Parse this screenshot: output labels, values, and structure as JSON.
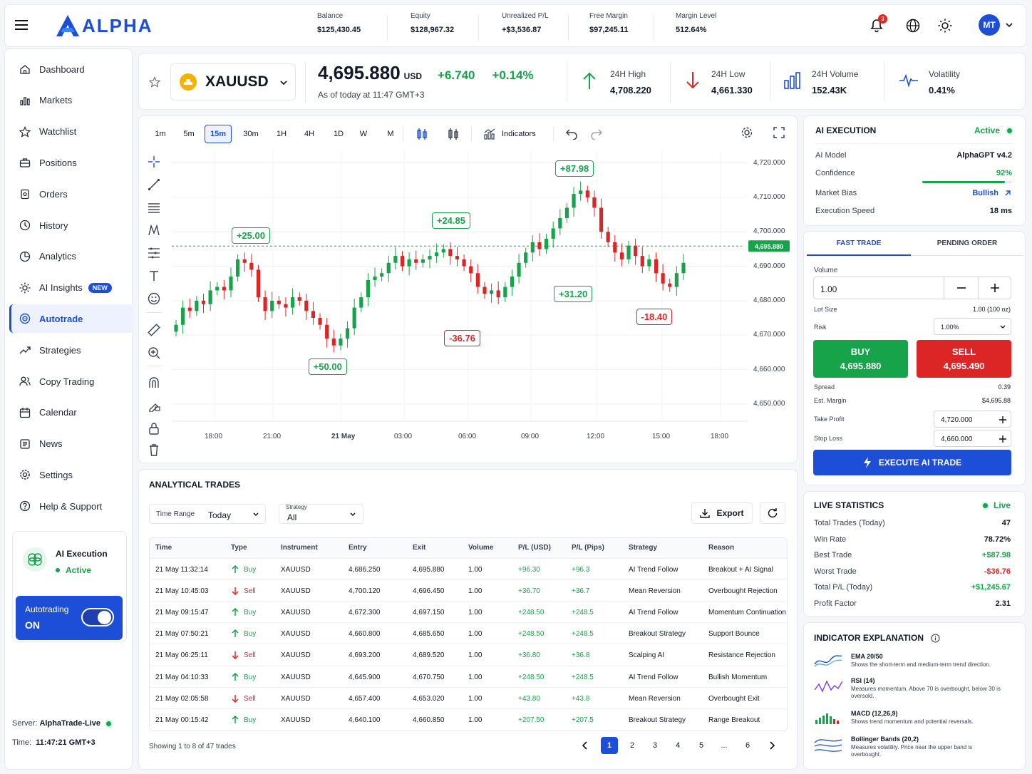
{
  "brand": {
    "name": "ALPHA"
  },
  "header": {
    "stats": [
      {
        "label": "Balance",
        "value": "$125,430.45"
      },
      {
        "label": "Equity",
        "value": "$128,967.32"
      },
      {
        "label": "Unrealized P/L",
        "value": "+$3,536.87"
      },
      {
        "label": "Free Margin",
        "value": "$97,245.11"
      },
      {
        "label": "Margin Level",
        "value": "512.64%"
      }
    ],
    "notification_count": "3",
    "avatar_initials": "MT"
  },
  "sidebar": {
    "items": [
      {
        "label": "Dashboard",
        "icon": "home-icon"
      },
      {
        "label": "Markets",
        "icon": "bar-chart-icon"
      },
      {
        "label": "Watchlist",
        "icon": "star-icon"
      },
      {
        "label": "Positions",
        "icon": "briefcase-icon"
      },
      {
        "label": "Orders",
        "icon": "clipboard-icon"
      },
      {
        "label": "History",
        "icon": "clock-icon"
      },
      {
        "label": "Analytics",
        "icon": "pie-icon"
      },
      {
        "label": "AI Insights",
        "icon": "sun-ai-icon",
        "badge": "NEW"
      },
      {
        "label": "Autotrade",
        "icon": "target-icon",
        "active": true
      },
      {
        "label": "Strategies",
        "icon": "trend-icon"
      },
      {
        "label": "Copy Trading",
        "icon": "users-icon"
      },
      {
        "label": "Calendar",
        "icon": "calendar-icon"
      },
      {
        "label": "News",
        "icon": "news-icon"
      },
      {
        "label": "Settings",
        "icon": "gear-icon"
      },
      {
        "label": "Help & Support",
        "icon": "help-icon"
      }
    ],
    "ai_card": {
      "title": "AI Execution",
      "status": "Active"
    },
    "autotrading": {
      "label": "Autotrading",
      "state": "ON"
    },
    "server_label": "Server:",
    "server": "AlphaTrade-Live",
    "time_label": "Time:",
    "time": "11:47:21 GMT+3"
  },
  "ticker": {
    "symbol": "XAUUSD",
    "price": "4,695.880",
    "currency": "USD",
    "change": "+6.740",
    "change_pct": "+0.14%",
    "asof": "As of today at 11:47 GMT+3",
    "high_label": "24H High",
    "high": "4,708.220",
    "low_label": "24H Low",
    "low": "4,661.330",
    "volume_label": "24H Volume",
    "volume": "152.43K",
    "volatility_label": "Volatility",
    "volatility": "0.41%"
  },
  "toolbar": {
    "timeframes": [
      "1m",
      "5m",
      "15m",
      "30m",
      "1H",
      "4H",
      "1D",
      "W",
      "M"
    ],
    "selected": "15m",
    "indicators_label": "Indicators"
  },
  "chart_data": {
    "type": "candlestick",
    "symbol": "XAUUSD",
    "x_ticks": [
      "18:00",
      "21:00",
      "21 May",
      "03:00",
      "06:00",
      "09:00",
      "12:00",
      "15:00",
      "18:00"
    ],
    "y_ticks": [
      "4,720.000",
      "4,710.000",
      "4,700.000",
      "4,690.000",
      "4,680.000",
      "4,670.000",
      "4,660.000",
      "4,650.000"
    ],
    "ylim": [
      4645,
      4722
    ],
    "current_price_label": "4,695.880",
    "current_price": 4695.88,
    "closes": [
      4673,
      4678,
      4677,
      4680,
      4679,
      4683,
      4684,
      4683,
      4687,
      4692,
      4691,
      4689,
      4681,
      4677,
      4680,
      4679,
      4678,
      4681,
      4680,
      4677,
      4675,
      4673,
      4669,
      4667,
      4669,
      4672,
      4678,
      4681,
      4686,
      4687,
      4688,
      4691,
      4693,
      4690,
      4692,
      4691,
      4692,
      4693,
      4694,
      4695,
      4693,
      4692,
      4690,
      4688,
      4684,
      4682,
      4683,
      4681,
      4684,
      4687,
      4691,
      4694,
      4697,
      4695,
      4698,
      4701,
      4704,
      4707,
      4711,
      4712,
      4710,
      4707,
      4700,
      4697,
      4694,
      4692,
      4696,
      4693,
      4690,
      4692,
      4688,
      4685,
      4684,
      4688,
      4691
    ],
    "annotations": [
      {
        "label": "+25.00",
        "price": 4693,
        "index": 11,
        "type": "gain"
      },
      {
        "label": "+50.00",
        "price": 4667,
        "index": 22,
        "type": "gain"
      },
      {
        "label": "+24.85",
        "price": 4697,
        "index": 40,
        "type": "gain"
      },
      {
        "label": "-36.76",
        "price": 4676,
        "index": 42,
        "type": "loss"
      },
      {
        "label": "+87.98",
        "price": 4712,
        "index": 58,
        "type": "gain"
      },
      {
        "label": "+31.20",
        "price": 4686,
        "index": 58,
        "type": "gain"
      },
      {
        "label": "-18.40",
        "price": 4683,
        "index": 70,
        "type": "loss"
      }
    ]
  },
  "trades": {
    "title": "ANALYTICAL TRADES",
    "time_range_label": "Time Range",
    "time_range": "Today",
    "strategy_label": "Strategy",
    "strategy": "All",
    "export_label": "Export",
    "columns": [
      "Time",
      "Type",
      "Instrument",
      "Entry",
      "Exit",
      "Volume",
      "P/L (USD)",
      "P/L (Pips)",
      "Strategy",
      "Reason"
    ],
    "rows": [
      [
        "21 May 11:32:14",
        "Buy",
        "XAUUSD",
        "4,686.250",
        "4,695.880",
        "1.00",
        "+96.30",
        "+96.3",
        "AI Trend Follow",
        "Breakout + AI Signal"
      ],
      [
        "21 May 10:45:03",
        "Sell",
        "XAUUSD",
        "4,700.120",
        "4,696.450",
        "1.00",
        "+36.70",
        "+36.7",
        "Mean Reversion",
        "Overbought Rejection"
      ],
      [
        "21 May 09:15:47",
        "Buy",
        "XAUUSD",
        "4,672.300",
        "4,697.150",
        "1.00",
        "+248.50",
        "+248.5",
        "AI Trend Follow",
        "Momentum Continuation"
      ],
      [
        "21 May 07:50:21",
        "Buy",
        "XAUUSD",
        "4,660.800",
        "4,685.650",
        "1.00",
        "+248.50",
        "+248.5",
        "Breakout Strategy",
        "Support Bounce"
      ],
      [
        "21 May 06:25:11",
        "Sell",
        "XAUUSD",
        "4,693.200",
        "4,689.520",
        "1.00",
        "+36.80",
        "+36.8",
        "Scalping AI",
        "Resistance Rejection"
      ],
      [
        "21 May 04:10:33",
        "Buy",
        "XAUUSD",
        "4,645.900",
        "4,670.750",
        "1.00",
        "+248.50",
        "+248.5",
        "AI Trend Follow",
        "Bullish Momentum"
      ],
      [
        "21 May 02:05:58",
        "Sell",
        "XAUUSD",
        "4,657.400",
        "4,653.020",
        "1.00",
        "+43.80",
        "+43.8",
        "Mean Reversion",
        "Overbought Exit"
      ],
      [
        "21 May 00:15:42",
        "Buy",
        "XAUUSD",
        "4,640.100",
        "4,660.850",
        "1.00",
        "+207.50",
        "+207.5",
        "Breakout Strategy",
        "Range Breakout"
      ]
    ],
    "showing": "Showing 1 to 8 of 47 trades",
    "pages": [
      "1",
      "2",
      "3",
      "4",
      "5",
      "...",
      "6"
    ],
    "current_page": "1"
  },
  "ai_exec": {
    "title": "AI EXECUTION",
    "status": "Active",
    "rows": [
      {
        "label": "AI Model",
        "value": "AlphaGPT v4.2"
      },
      {
        "label": "Confidence",
        "value": "92%"
      },
      {
        "label": "Market Bias",
        "value": "Bullish"
      },
      {
        "label": "Execution Speed",
        "value": "18 ms"
      }
    ],
    "confidence": 0.92
  },
  "trade_panel": {
    "tabs": [
      "FAST TRADE",
      "PENDING ORDER"
    ],
    "volume_label": "Volume",
    "volume": "1.00",
    "lot_label": "Lot Size",
    "lot": "1.00 (100 oz)",
    "risk_label": "Risk",
    "risk": "1.00%",
    "buy_label": "BUY",
    "buy_price": "4,695.880",
    "sell_label": "SELL",
    "sell_price": "4,695.490",
    "spread_label": "Spread",
    "spread": "0.39",
    "margin_label": "Est. Margin",
    "margin": "$4,695.88",
    "tp_label": "Take Profit",
    "tp": "4,720.000",
    "sl_label": "Stop Loss",
    "sl": "4,660.000",
    "execute_label": "EXECUTE AI TRADE"
  },
  "live_stats": {
    "title": "LIVE STATISTICS",
    "status": "Live",
    "rows": [
      {
        "label": "Total Trades (Today)",
        "value": "47",
        "tone": ""
      },
      {
        "label": "Win Rate",
        "value": "78.72%",
        "tone": ""
      },
      {
        "label": "Best Trade",
        "value": "+$87.98",
        "tone": "pos"
      },
      {
        "label": "Worst Trade",
        "value": "-$36.76",
        "tone": "neg"
      },
      {
        "label": "Total P/L (Today)",
        "value": "+$1,245.67",
        "tone": "pos"
      },
      {
        "label": "Profit Factor",
        "value": "2.31",
        "tone": ""
      }
    ]
  },
  "indicators": {
    "title": "INDICATOR EXPLANATION",
    "items": [
      {
        "name": "EMA 20/50",
        "desc": "Shows the short-term and medium-term trend direction."
      },
      {
        "name": "RSI (14)",
        "desc": "Measures momentum. Above 70 is overbought, below 30 is oversold."
      },
      {
        "name": "MACD (12,26,9)",
        "desc": "Shows trend momentum and potential reversals."
      },
      {
        "name": "Bollinger Bands (20,2)",
        "desc": "Measures volatility. Price near the upper band is overbought."
      }
    ]
  },
  "colors": {
    "accent": "#1d4ed8",
    "positive": "#16a34a",
    "negative": "#dc2626",
    "buy": "#16a34a",
    "sell": "#dc2626"
  }
}
